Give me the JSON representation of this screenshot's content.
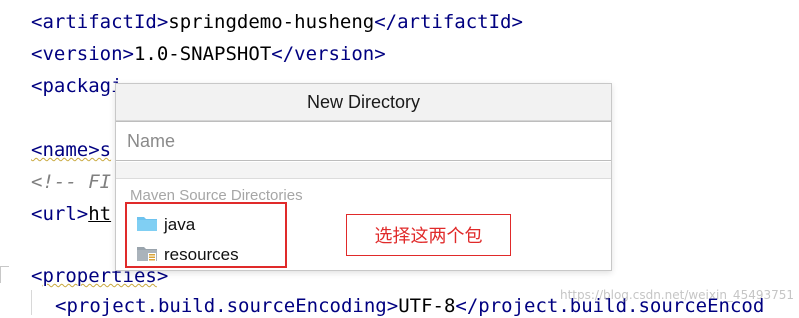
{
  "editor": {
    "lines": [
      {
        "open_tag": "artifactId",
        "text": "springdemo-husheng",
        "close_tag": "artifactId"
      },
      {
        "open_tag": "version",
        "text": "1.0-SNAPSHOT",
        "close_tag": "version"
      },
      {
        "prefix": "<packagi"
      },
      {
        "prefix": "<name>s"
      },
      {
        "comment": "<!-- FI"
      },
      {
        "prefix": "<url>",
        "under": "ht"
      },
      {
        "open_tag": "properties"
      },
      {
        "open_tag": "project.build.sourceEncoding",
        "text": "UTF-8",
        "close_tag": "project.build.sourceEncod"
      }
    ],
    "watermark": "https://blog.csdn.net/weixin_45493751"
  },
  "dialog": {
    "title": "New Directory",
    "name_placeholder": "Name",
    "section_label": "Maven Source Directories",
    "items": [
      {
        "label": "java",
        "icon": "blue-folder-icon"
      },
      {
        "label": "resources",
        "icon": "resources-folder-icon"
      }
    ]
  },
  "annotation": {
    "callout": "选择这两个包",
    "color": "#e02a2a"
  }
}
